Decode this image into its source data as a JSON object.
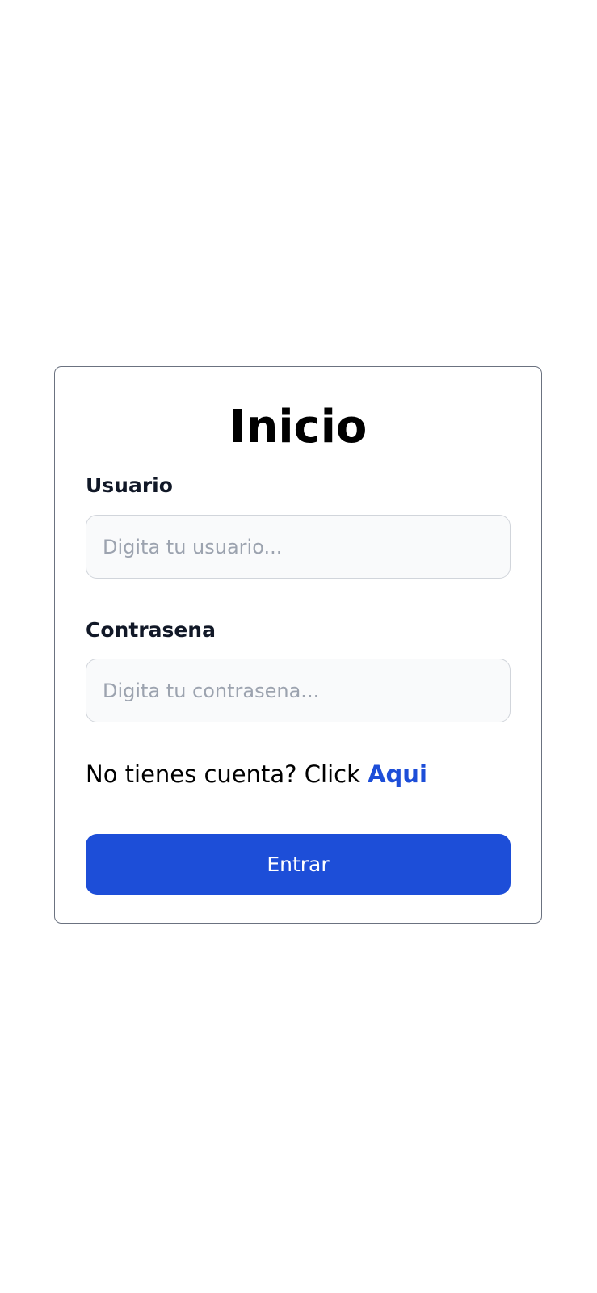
{
  "login": {
    "title": "Inicio",
    "username": {
      "label": "Usuario",
      "value": "",
      "placeholder": "Digita tu usuario..."
    },
    "password": {
      "label": "Contrasena",
      "value": "",
      "placeholder": "Digita tu contrasena..."
    },
    "signup_prompt": "No tienes cuenta? Click ",
    "signup_link": "Aqui",
    "submit_label": "Entrar"
  },
  "colors": {
    "accent": "#1d4ed8",
    "card_border": "#6b7280",
    "input_bg": "#f9fafb",
    "input_border": "#d1d5db",
    "placeholder": "#9ca3af"
  }
}
